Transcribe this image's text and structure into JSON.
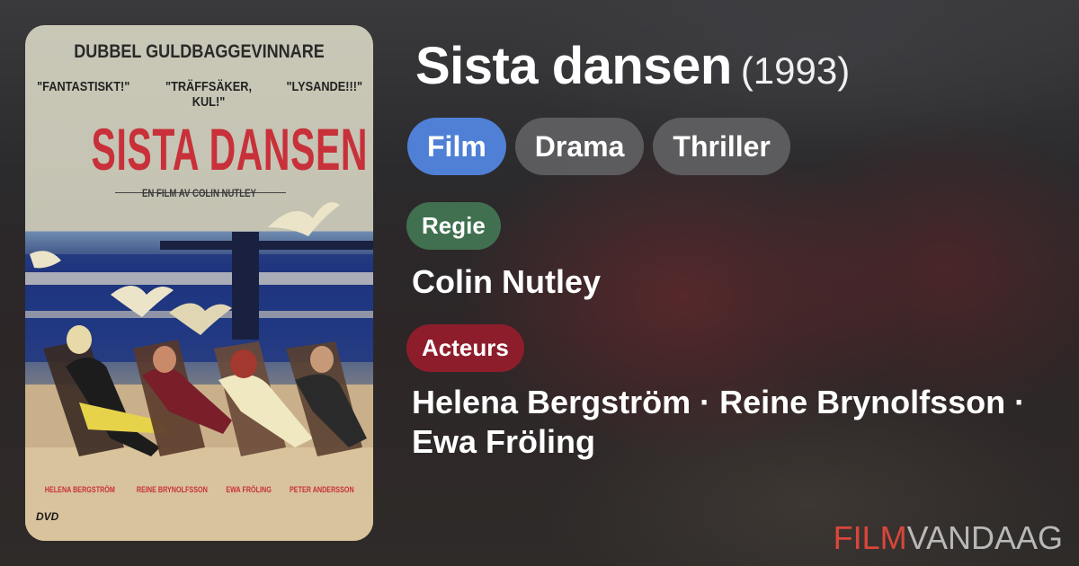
{
  "movie": {
    "title": "Sista dansen",
    "year": "(1993)"
  },
  "genres": [
    {
      "label": "Film",
      "active": true
    },
    {
      "label": "Drama",
      "active": false
    },
    {
      "label": "Thriller",
      "active": false
    }
  ],
  "director": {
    "label": "Regie",
    "name": "Colin Nutley"
  },
  "actors": {
    "label": "Acteurs",
    "names": "Helena Bergström · Reine Brynolfsson · Ewa Fröling"
  },
  "poster": {
    "award": "DUBBEL GULDBAGGEVINNARE",
    "quotes": [
      "\"FANTASTISKT!\"",
      "\"TRÄFFSÄKER, KUL!\"",
      "\"LYSANDE!!!\""
    ],
    "title": "SISTA DANSEN",
    "subtitle": "EN FILM AV COLIN NUTLEY",
    "cast": [
      "HELENA BERGSTRÖM",
      "REINE BRYNOLFSSON",
      "EWA FRÖLING",
      "PETER ANDERSSON"
    ],
    "format": "DVD"
  },
  "brand": {
    "part1": "FILM",
    "part2": "VANDAAG"
  },
  "colors": {
    "genre_active": "#4f80d6",
    "regie": "#40704f",
    "acteurs": "#8e1d2c",
    "brand_red": "#d9463b"
  }
}
